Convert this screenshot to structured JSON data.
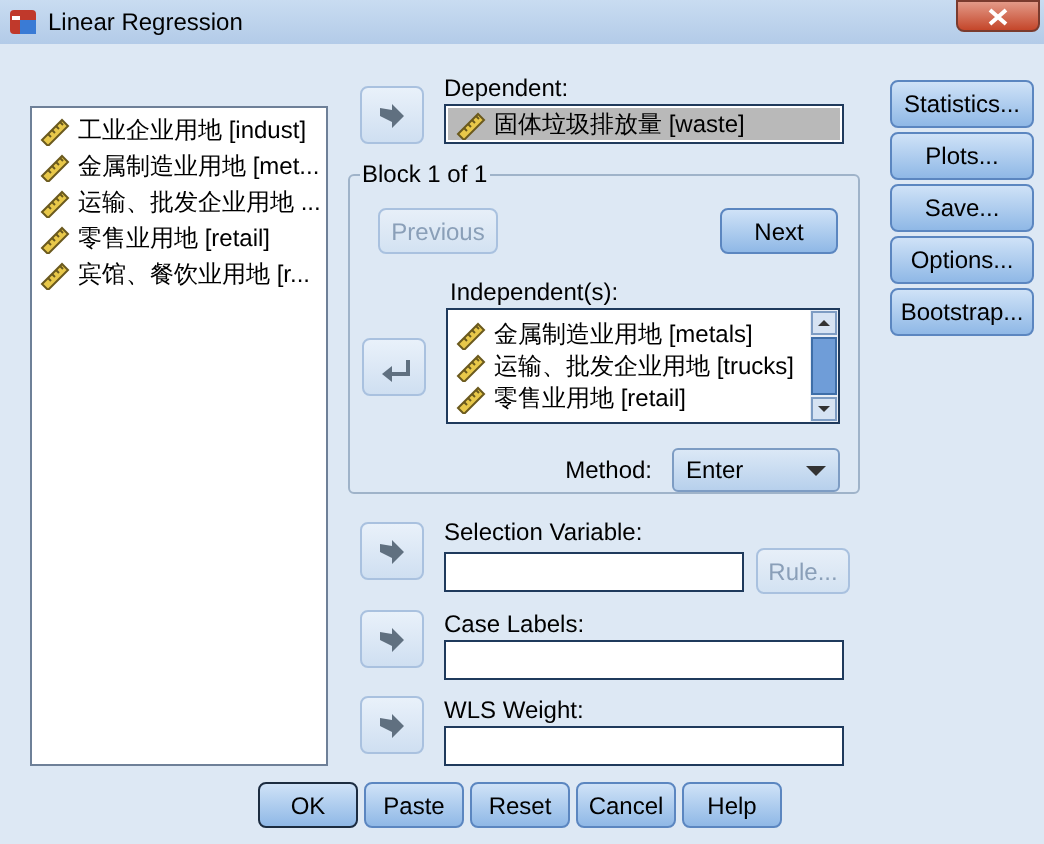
{
  "window": {
    "title": "Linear Regression"
  },
  "variables": [
    "工业企业用地 [indust]",
    "金属制造业用地 [met...",
    "运输、批发企业用地 ...",
    "零售业用地 [retail]",
    "宾馆、餐饮业用地 [r..."
  ],
  "dependent": {
    "label": "Dependent:",
    "value": "固体垃圾排放量 [waste]",
    "selected": true
  },
  "block": {
    "title": "Block 1 of 1",
    "previous": {
      "label": "Previous",
      "disabled": true
    },
    "next": {
      "label": "Next",
      "disabled": false
    },
    "independents_label": "Independent(s):",
    "independents": [
      "金属制造业用地 [metals]",
      "运输、批发企业用地 [trucks]",
      "零售业用地 [retail]"
    ],
    "method_label": "Method:",
    "method": "Enter"
  },
  "selection": {
    "label": "Selection Variable:",
    "rule": {
      "label": "Rule...",
      "disabled": true
    }
  },
  "case_labels": {
    "label": "Case Labels:"
  },
  "wls": {
    "label": "WLS Weight:"
  },
  "side_buttons": [
    "Statistics...",
    "Plots...",
    "Save...",
    "Options...",
    "Bootstrap..."
  ],
  "buttons": [
    {
      "label": "OK",
      "default": true
    },
    {
      "label": "Paste",
      "default": false
    },
    {
      "label": "Reset",
      "default": false
    },
    {
      "label": "Cancel",
      "default": false
    },
    {
      "label": "Help",
      "default": false
    }
  ]
}
